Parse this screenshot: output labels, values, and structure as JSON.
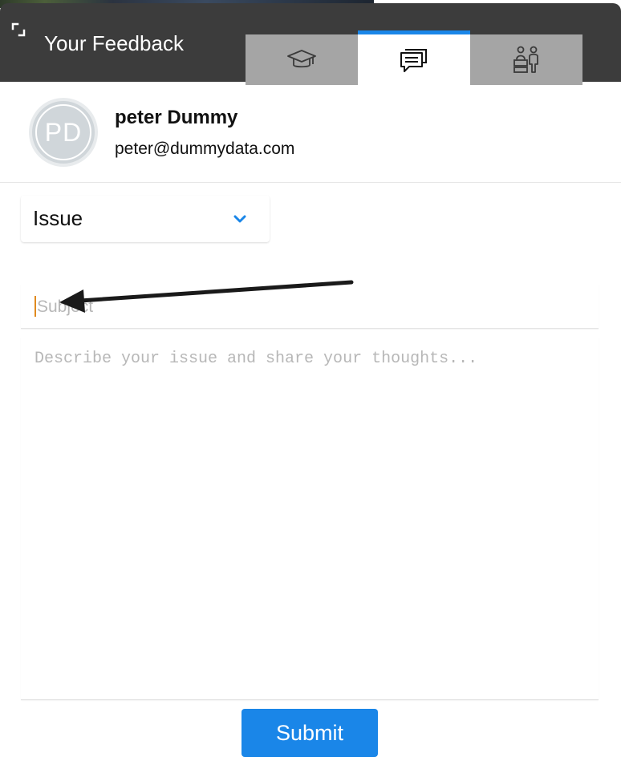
{
  "header": {
    "title": "Your Feedback",
    "background_color": "#3c3c3c",
    "tabs": [
      {
        "icon": "graduation-cap-icon",
        "active": false
      },
      {
        "icon": "chat-bubbles-icon",
        "active": true
      },
      {
        "icon": "presenter-audience-icon",
        "active": false
      }
    ],
    "active_tab_accent": "#1a86e8"
  },
  "user": {
    "initials": "PD",
    "name": "peter Dummy",
    "email": "peter@dummydata.com"
  },
  "form": {
    "type_selected": "Issue",
    "subject_placeholder": "Subject",
    "description_placeholder": "Describe your issue and share your thoughts...",
    "submit_label": "Submit",
    "accent_color": "#1a86e8"
  }
}
